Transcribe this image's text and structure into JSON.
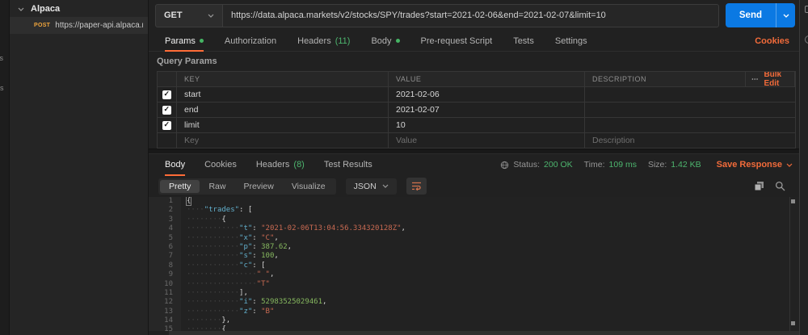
{
  "colors": {
    "accent_orange": "#ff6c37",
    "send_blue": "#0b79e3",
    "success_green": "#4db56e",
    "method_post_yellow": "#f2a73d",
    "syntax_key": "#63b0cd",
    "syntax_string": "#c96a52",
    "syntax_number": "#86b85f"
  },
  "left_rail": {
    "fragments": [
      "ts",
      "rs"
    ]
  },
  "sidebar": {
    "collection_name": "Alpaca",
    "request_method": "POST",
    "request_url": "https://paper-api.alpaca.market..."
  },
  "request_bar": {
    "method": "GET",
    "url": "https://data.alpaca.markets/v2/stocks/SPY/trades?start=2021-02-06&end=2021-02-07&limit=10",
    "send_label": "Send"
  },
  "request_tabs": {
    "params": "Params",
    "authorization": "Authorization",
    "headers": "Headers",
    "headers_count": "(11)",
    "body": "Body",
    "pre_request": "Pre-request Script",
    "tests": "Tests",
    "settings": "Settings",
    "cookies": "Cookies"
  },
  "query_params": {
    "title": "Query Params",
    "col_key": "KEY",
    "col_value": "VALUE",
    "col_description": "DESCRIPTION",
    "bulk_edit": "Bulk Edit",
    "rows": [
      {
        "key": "start",
        "value": "2021-02-06"
      },
      {
        "key": "end",
        "value": "2021-02-07"
      },
      {
        "key": "limit",
        "value": "10"
      }
    ],
    "placeholder": {
      "key": "Key",
      "value": "Value",
      "description": "Description"
    }
  },
  "response": {
    "tab_body": "Body",
    "tab_cookies": "Cookies",
    "tab_headers": "Headers",
    "headers_count": "(8)",
    "tab_test_results": "Test Results",
    "status_label": "Status:",
    "status_value": "200 OK",
    "time_label": "Time:",
    "time_value": "109 ms",
    "size_label": "Size:",
    "size_value": "1.42 KB",
    "save_response": "Save Response",
    "view_pretty": "Pretty",
    "view_raw": "Raw",
    "view_preview": "Preview",
    "view_visualize": "Visualize",
    "format": "JSON"
  },
  "code": {
    "lines": [
      {
        "n": 1,
        "indent": 0,
        "cursor": true,
        "tokens": [
          [
            "pun",
            "{"
          ]
        ]
      },
      {
        "n": 2,
        "indent": 4,
        "tokens": [
          [
            "key",
            "\"trades\""
          ],
          [
            "pun",
            ": ["
          ]
        ]
      },
      {
        "n": 3,
        "indent": 8,
        "tokens": [
          [
            "pun",
            "{"
          ]
        ]
      },
      {
        "n": 4,
        "indent": 12,
        "tokens": [
          [
            "key",
            "\"t\""
          ],
          [
            "pun",
            ": "
          ],
          [
            "str",
            "\"2021-02-06T13:04:56.334320128Z\""
          ],
          [
            "pun",
            ","
          ]
        ]
      },
      {
        "n": 5,
        "indent": 12,
        "tokens": [
          [
            "key",
            "\"x\""
          ],
          [
            "pun",
            ": "
          ],
          [
            "str",
            "\"C\""
          ],
          [
            "pun",
            ","
          ]
        ]
      },
      {
        "n": 6,
        "indent": 12,
        "tokens": [
          [
            "key",
            "\"p\""
          ],
          [
            "pun",
            ": "
          ],
          [
            "num",
            "387.62"
          ],
          [
            "pun",
            ","
          ]
        ]
      },
      {
        "n": 7,
        "indent": 12,
        "tokens": [
          [
            "key",
            "\"s\""
          ],
          [
            "pun",
            ": "
          ],
          [
            "num",
            "100"
          ],
          [
            "pun",
            ","
          ]
        ]
      },
      {
        "n": 8,
        "indent": 12,
        "tokens": [
          [
            "key",
            "\"c\""
          ],
          [
            "pun",
            ": ["
          ]
        ]
      },
      {
        "n": 9,
        "indent": 16,
        "tokens": [
          [
            "str",
            "\" \""
          ],
          [
            "pun",
            ","
          ]
        ]
      },
      {
        "n": 10,
        "indent": 16,
        "tokens": [
          [
            "str",
            "\"T\""
          ]
        ]
      },
      {
        "n": 11,
        "indent": 12,
        "tokens": [
          [
            "pun",
            "],"
          ]
        ]
      },
      {
        "n": 12,
        "indent": 12,
        "tokens": [
          [
            "key",
            "\"i\""
          ],
          [
            "pun",
            ": "
          ],
          [
            "num",
            "52983525029461"
          ],
          [
            "pun",
            ","
          ]
        ]
      },
      {
        "n": 13,
        "indent": 12,
        "tokens": [
          [
            "key",
            "\"z\""
          ],
          [
            "pun",
            ": "
          ],
          [
            "str",
            "\"B\""
          ]
        ]
      },
      {
        "n": 14,
        "indent": 8,
        "tokens": [
          [
            "pun",
            "},"
          ]
        ]
      },
      {
        "n": 15,
        "indent": 8,
        "tokens": [
          [
            "pun",
            "{"
          ]
        ]
      }
    ]
  }
}
